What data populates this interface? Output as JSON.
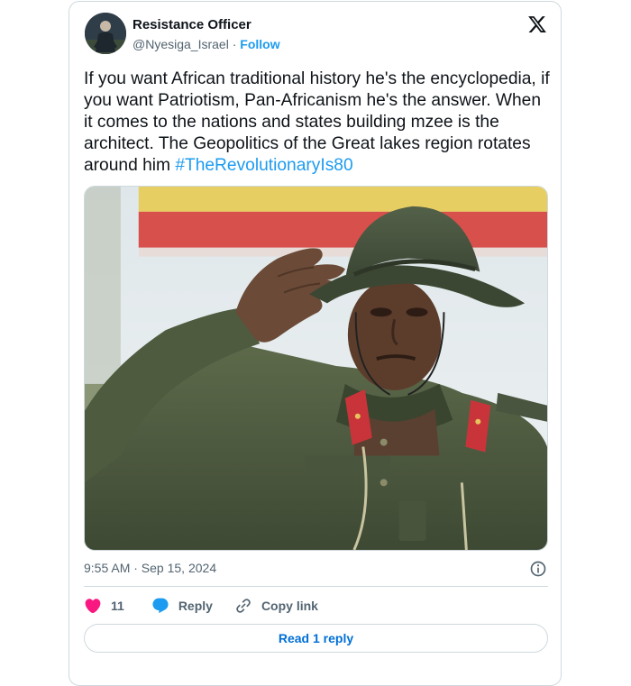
{
  "author": {
    "name": "Resistance Officer",
    "handle": "@Nyesiga_Israel",
    "separator": "·",
    "follow_label": "Follow"
  },
  "tweet": {
    "text": "If you want African traditional history he's the encyclopedia, if you want Patriotism, Pan-Africanism he's the answer. When it comes to the nations and states building mzee is the architect. The Geopolitics of the Great lakes region rotates around him ",
    "hashtag": "#TheRevolutionaryIs80",
    "timestamp": "9:55 AM · Sep 15, 2024"
  },
  "actions": {
    "like_count": "11",
    "reply_label": "Reply",
    "copy_link_label": "Copy link"
  },
  "read_replies_label": "Read 1 reply",
  "colors": {
    "accent": "#1d9bf0",
    "like": "#f91880",
    "muted": "#536471",
    "border": "#cfd9de"
  },
  "icons": {
    "logo": "x-logo-icon",
    "info": "info-icon",
    "like": "heart-icon",
    "reply": "speech-bubble-icon",
    "copy_link": "link-icon"
  }
}
